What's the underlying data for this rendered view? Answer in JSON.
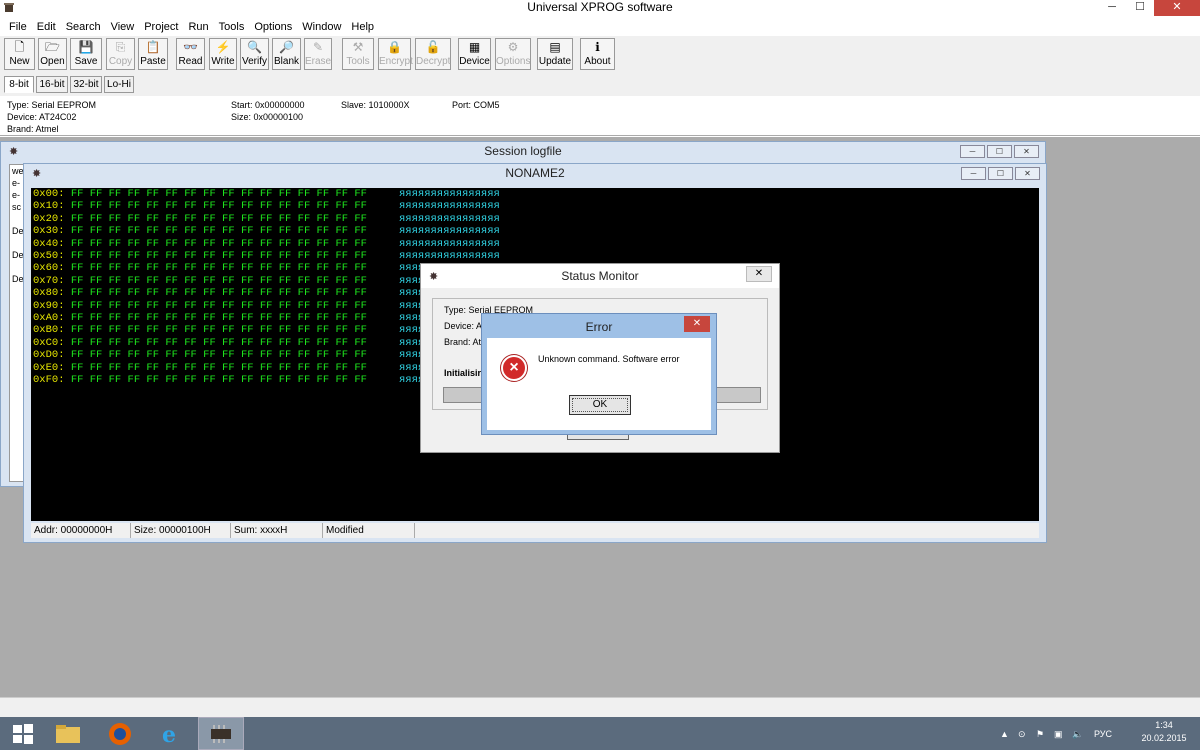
{
  "app": {
    "title": "Universal XPROG software",
    "minimize": "─",
    "maximize": "☐",
    "close": "✕"
  },
  "menu": [
    "File",
    "Edit",
    "Search",
    "View",
    "Project",
    "Run",
    "Tools",
    "Options",
    "Window",
    "Help"
  ],
  "toolbar": [
    {
      "label": "New",
      "icon": "new-icon",
      "glyph": "🗋",
      "enabled": true
    },
    {
      "label": "Open",
      "icon": "open-icon",
      "glyph": "🗁",
      "enabled": true
    },
    {
      "label": "Save",
      "icon": "save-icon",
      "glyph": "💾",
      "enabled": true
    },
    {
      "label": "Copy",
      "icon": "copy-icon",
      "glyph": "⎘",
      "enabled": false
    },
    {
      "label": "Paste",
      "icon": "paste-icon",
      "glyph": "📋",
      "enabled": true
    },
    {
      "label": "Read",
      "icon": "read-icon",
      "glyph": "👓",
      "enabled": true
    },
    {
      "label": "Write",
      "icon": "write-icon",
      "glyph": "⚡",
      "enabled": true
    },
    {
      "label": "Verify",
      "icon": "verify-icon",
      "glyph": "🔍",
      "enabled": true
    },
    {
      "label": "Blank",
      "icon": "blank-icon",
      "glyph": "🔎",
      "enabled": true
    },
    {
      "label": "Erase",
      "icon": "erase-icon",
      "glyph": "✎",
      "enabled": false
    },
    {
      "label": "Tools",
      "icon": "tools-icon",
      "glyph": "⚒",
      "enabled": false
    },
    {
      "label": "Encrypt",
      "icon": "encrypt-icon",
      "glyph": "🔒",
      "enabled": false
    },
    {
      "label": "Decrypt",
      "icon": "decrypt-icon",
      "glyph": "🔓",
      "enabled": false
    },
    {
      "label": "Device",
      "icon": "device-icon",
      "glyph": "▦",
      "enabled": true
    },
    {
      "label": "Options",
      "icon": "options-icon",
      "glyph": "⚙",
      "enabled": false
    },
    {
      "label": "Update",
      "icon": "update-icon",
      "glyph": "▤",
      "enabled": true
    },
    {
      "label": "About",
      "icon": "about-icon",
      "glyph": "ℹ",
      "enabled": true
    }
  ],
  "tabs": [
    "8-bit",
    "16-bit",
    "32-bit",
    "Lo-Hi"
  ],
  "active_tab": "8-bit",
  "info": {
    "type": "Type: Serial EEPROM",
    "device": "Device: AT24C02",
    "brand": "Brand: Atmel",
    "start": "Start: 0x00000000",
    "size": "Size: 0x00000100",
    "slave": "Slave: 1010000X",
    "port": "Port: COM5"
  },
  "session_log": {
    "title": "Session logfile",
    "lines": [
      "we",
      "e-",
      "e-",
      "sc",
      "",
      "De",
      "",
      "De",
      "",
      "De"
    ]
  },
  "editor": {
    "title": "NONAME2",
    "byte_value": "FF",
    "ascii": "яяяяяяяяяяяяяяяя",
    "rows": [
      "0x00:",
      "0x10:",
      "0x20:",
      "0x30:",
      "0x40:",
      "0x50:",
      "0x60:",
      "0x70:",
      "0x80:",
      "0x90:",
      "0xA0:",
      "0xB0:",
      "0xC0:",
      "0xD0:",
      "0xE0:",
      "0xF0:"
    ]
  },
  "status": {
    "addr": "Addr: 00000000H",
    "size": "Size: 00000100H",
    "sum": "Sum: xxxxH",
    "modified": "Modified"
  },
  "status_monitor": {
    "title": "Status Monitor",
    "type": "Type: Serial EEPROM",
    "device": "Device: A",
    "brand": "Brand: Atr",
    "initialising": "Initialisir"
  },
  "error_dialog": {
    "title": "Error",
    "message": "Unknown command. Software error",
    "ok": "OK",
    "icon": "×"
  },
  "taskbar": {
    "lang": "РУС",
    "time": "1:34",
    "date": "20.02.2015",
    "tray_up": "▲"
  }
}
